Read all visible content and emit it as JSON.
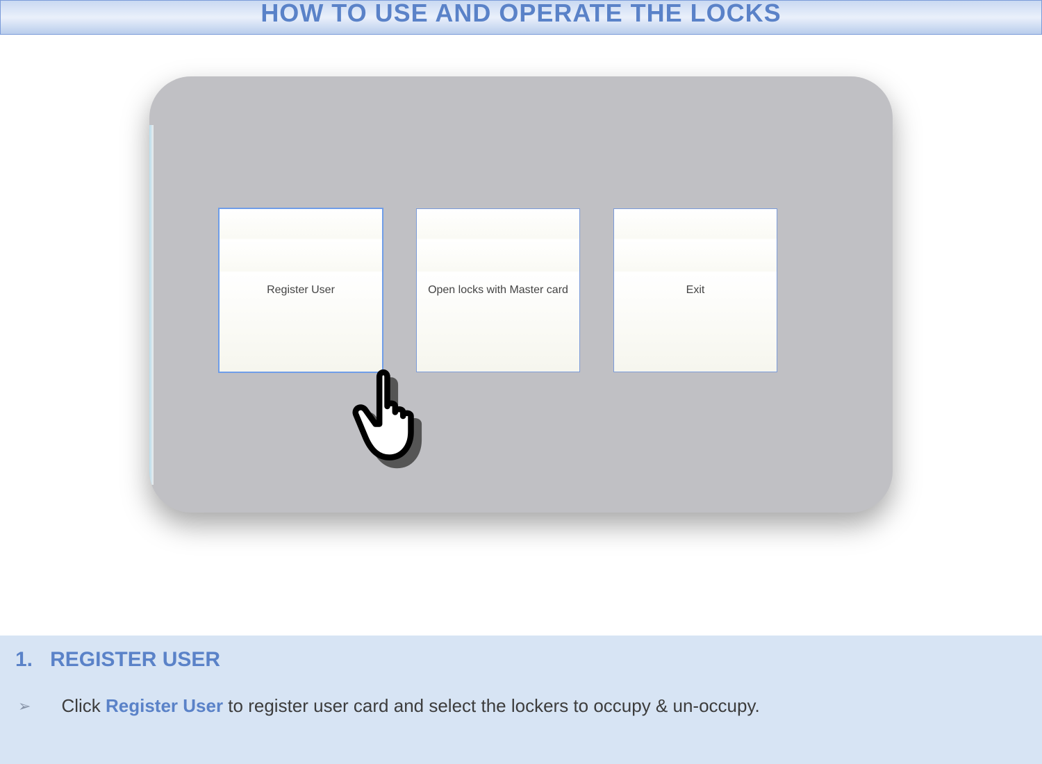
{
  "title": "HOW TO USE  AND OPERATE THE LOCKS",
  "buttons": {
    "register": "Register User",
    "open_master": "Open locks with Master card",
    "exit": "Exit"
  },
  "section": {
    "number": "1.",
    "label": "REGISTER USER"
  },
  "instruction": {
    "arrow": "➢",
    "before": "Click ",
    "highlight": "Register User",
    "after": " to register user card and select the lockers to occupy & un-occupy."
  }
}
